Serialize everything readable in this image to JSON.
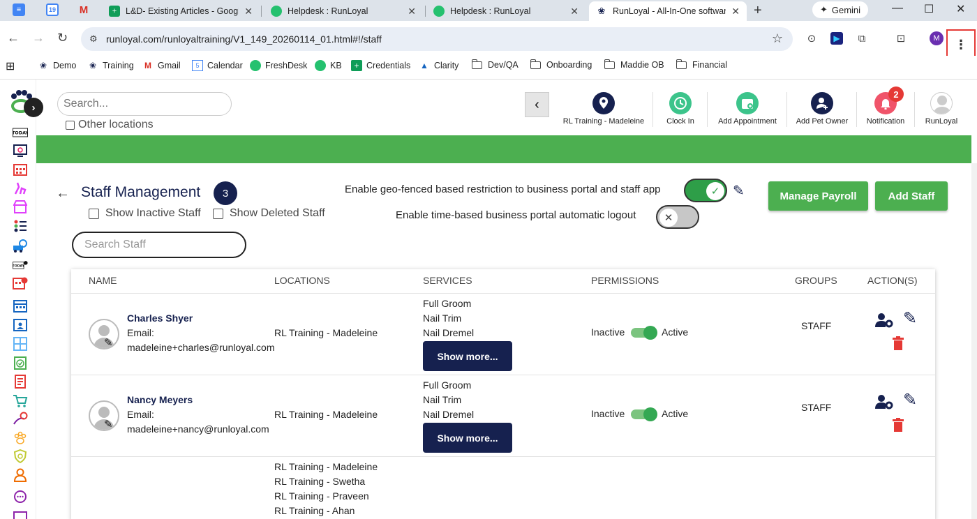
{
  "browser": {
    "tabs": [
      {
        "title": "L&D- Existing Articles - Google",
        "active": false
      },
      {
        "title": "Helpdesk : RunLoyal",
        "active": false
      },
      {
        "title": "Helpdesk : RunLoyal",
        "active": false
      },
      {
        "title": "RunLoyal - All-In-One software",
        "active": true
      }
    ],
    "calendar_badge": "19",
    "gemini_label": "Gemini",
    "url": "runloyal.com/runloyaltraining/V1_149_20260114_01.html#!/staff",
    "profile_initial": "M",
    "bookmarks": [
      "Demo",
      "Training",
      "Gmail",
      "Calendar",
      "FreshDesk",
      "KB",
      "Credentials",
      "Clarity",
      "Dev/QA",
      "Onboarding",
      "Maddie OB",
      "Financial"
    ],
    "calendar_bm_num": "5"
  },
  "app": {
    "search_placeholder": "Search...",
    "other_locations": "Other locations",
    "top_actions": [
      {
        "label": "RL Training - Madeleine",
        "icon": "location-pin-icon",
        "color": "#16214f"
      },
      {
        "label": "Clock In",
        "icon": "clock-icon",
        "color": "#3cc48b"
      },
      {
        "label": "Add Appointment",
        "icon": "calendar-add-icon",
        "color": "#3cc48b"
      },
      {
        "label": "Add Pet Owner",
        "icon": "add-person-icon",
        "color": "#16214f"
      },
      {
        "label": "Notification",
        "icon": "bell-icon",
        "color": "#f0546a",
        "badge": "2"
      },
      {
        "label": "RunLoyal",
        "icon": "user-avatar-icon",
        "color": "#cccccc"
      }
    ],
    "page_title": "Staff Management",
    "staff_count": "3",
    "show_inactive": "Show Inactive Staff",
    "show_deleted": "Show Deleted Staff",
    "geo_label": "Enable geo-fenced based restriction to business portal and staff app",
    "logout_label": "Enable time-based business portal automatic logout",
    "geo_enabled": true,
    "logout_enabled": false,
    "manage_payroll": "Manage Payroll",
    "add_staff": "Add Staff",
    "staff_search_placeholder": "Search Staff",
    "colors": {
      "primary_navy": "#16214f",
      "brand_green": "#4caf50",
      "delete_red": "#e53935"
    }
  },
  "table": {
    "headers": [
      "NAME",
      "LOCATIONS",
      "SERVICES",
      "PERMISSIONS",
      "GROUPS",
      "ACTION(S)"
    ],
    "rows": [
      {
        "name": "Charles Shyer",
        "email_label": "Email:",
        "email": "madeleine+charles@runloyal.com",
        "locations": [
          "RL Training - Madeleine"
        ],
        "services": [
          "Full Groom",
          "Nail Trim",
          "Nail Dremel"
        ],
        "show_more": "Show more...",
        "perm_off": "Inactive",
        "perm_on": "Active",
        "active": true,
        "group": "STAFF"
      },
      {
        "name": "Nancy Meyers",
        "email_label": "Email:",
        "email": "madeleine+nancy@runloyal.com",
        "locations": [
          "RL Training - Madeleine"
        ],
        "services": [
          "Full Groom",
          "Nail Trim",
          "Nail Dremel"
        ],
        "show_more": "Show more...",
        "perm_off": "Inactive",
        "perm_on": "Active",
        "active": true,
        "group": "STAFF"
      },
      {
        "locations": [
          "RL Training - Madeleine",
          "RL Training - Swetha",
          "RL Training - Praveen",
          "RL Training - Ahan"
        ]
      }
    ]
  }
}
